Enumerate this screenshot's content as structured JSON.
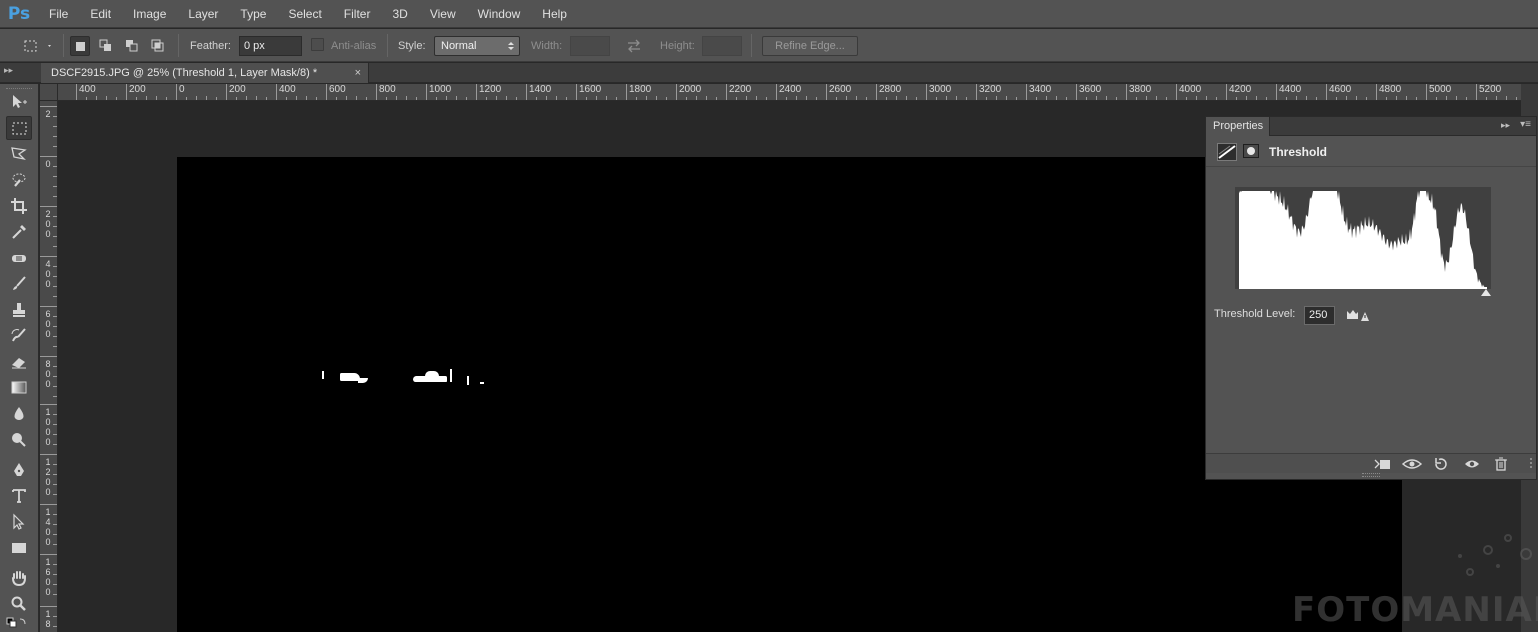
{
  "app": {
    "logo": "Ps"
  },
  "menu": [
    "File",
    "Edit",
    "Image",
    "Layer",
    "Type",
    "Select",
    "Filter",
    "3D",
    "View",
    "Window",
    "Help"
  ],
  "options": {
    "feather_label": "Feather:",
    "feather_value": "0 px",
    "antialias_label": "Anti-alias",
    "style_label": "Style:",
    "style_value": "Normal",
    "width_label": "Width:",
    "height_label": "Height:",
    "refine_edge_label": "Refine Edge..."
  },
  "document": {
    "tab_title": "DSCF2915.JPG @ 25% (Threshold 1, Layer Mask/8) *",
    "close_glyph": "×"
  },
  "ruler_top_labels": [
    "400",
    "200",
    "0",
    "200",
    "400",
    "600",
    "800",
    "1000",
    "1200",
    "1400",
    "1600",
    "1800",
    "2000",
    "2200",
    "2400",
    "2600",
    "2800",
    "3000",
    "3200",
    "3400",
    "3600",
    "3800",
    "4000",
    "4200",
    "4400",
    "4600",
    "4800",
    "5000",
    "5200"
  ],
  "ruler_left_labels": [
    "2",
    "0",
    "2\n0\n0",
    "4\n0\n0",
    "6\n0\n0",
    "8\n0\n0",
    "1\n0\n0\n0",
    "1\n2\n0\n0",
    "1\n4\n0\n0",
    "1\n6\n0\n0",
    "1\n8"
  ],
  "properties": {
    "tab_label": "Properties",
    "adjustment_name": "Threshold",
    "threshold_level_label": "Threshold Level:",
    "threshold_level_value": "250",
    "histogram_max_value": 255
  },
  "watermark": {
    "text": "FOTOMANIAK"
  },
  "colors": {
    "ui_panel": "#535353",
    "workspace": "#282828",
    "document": "#000000",
    "accent_logo": "#4aa0e0"
  }
}
